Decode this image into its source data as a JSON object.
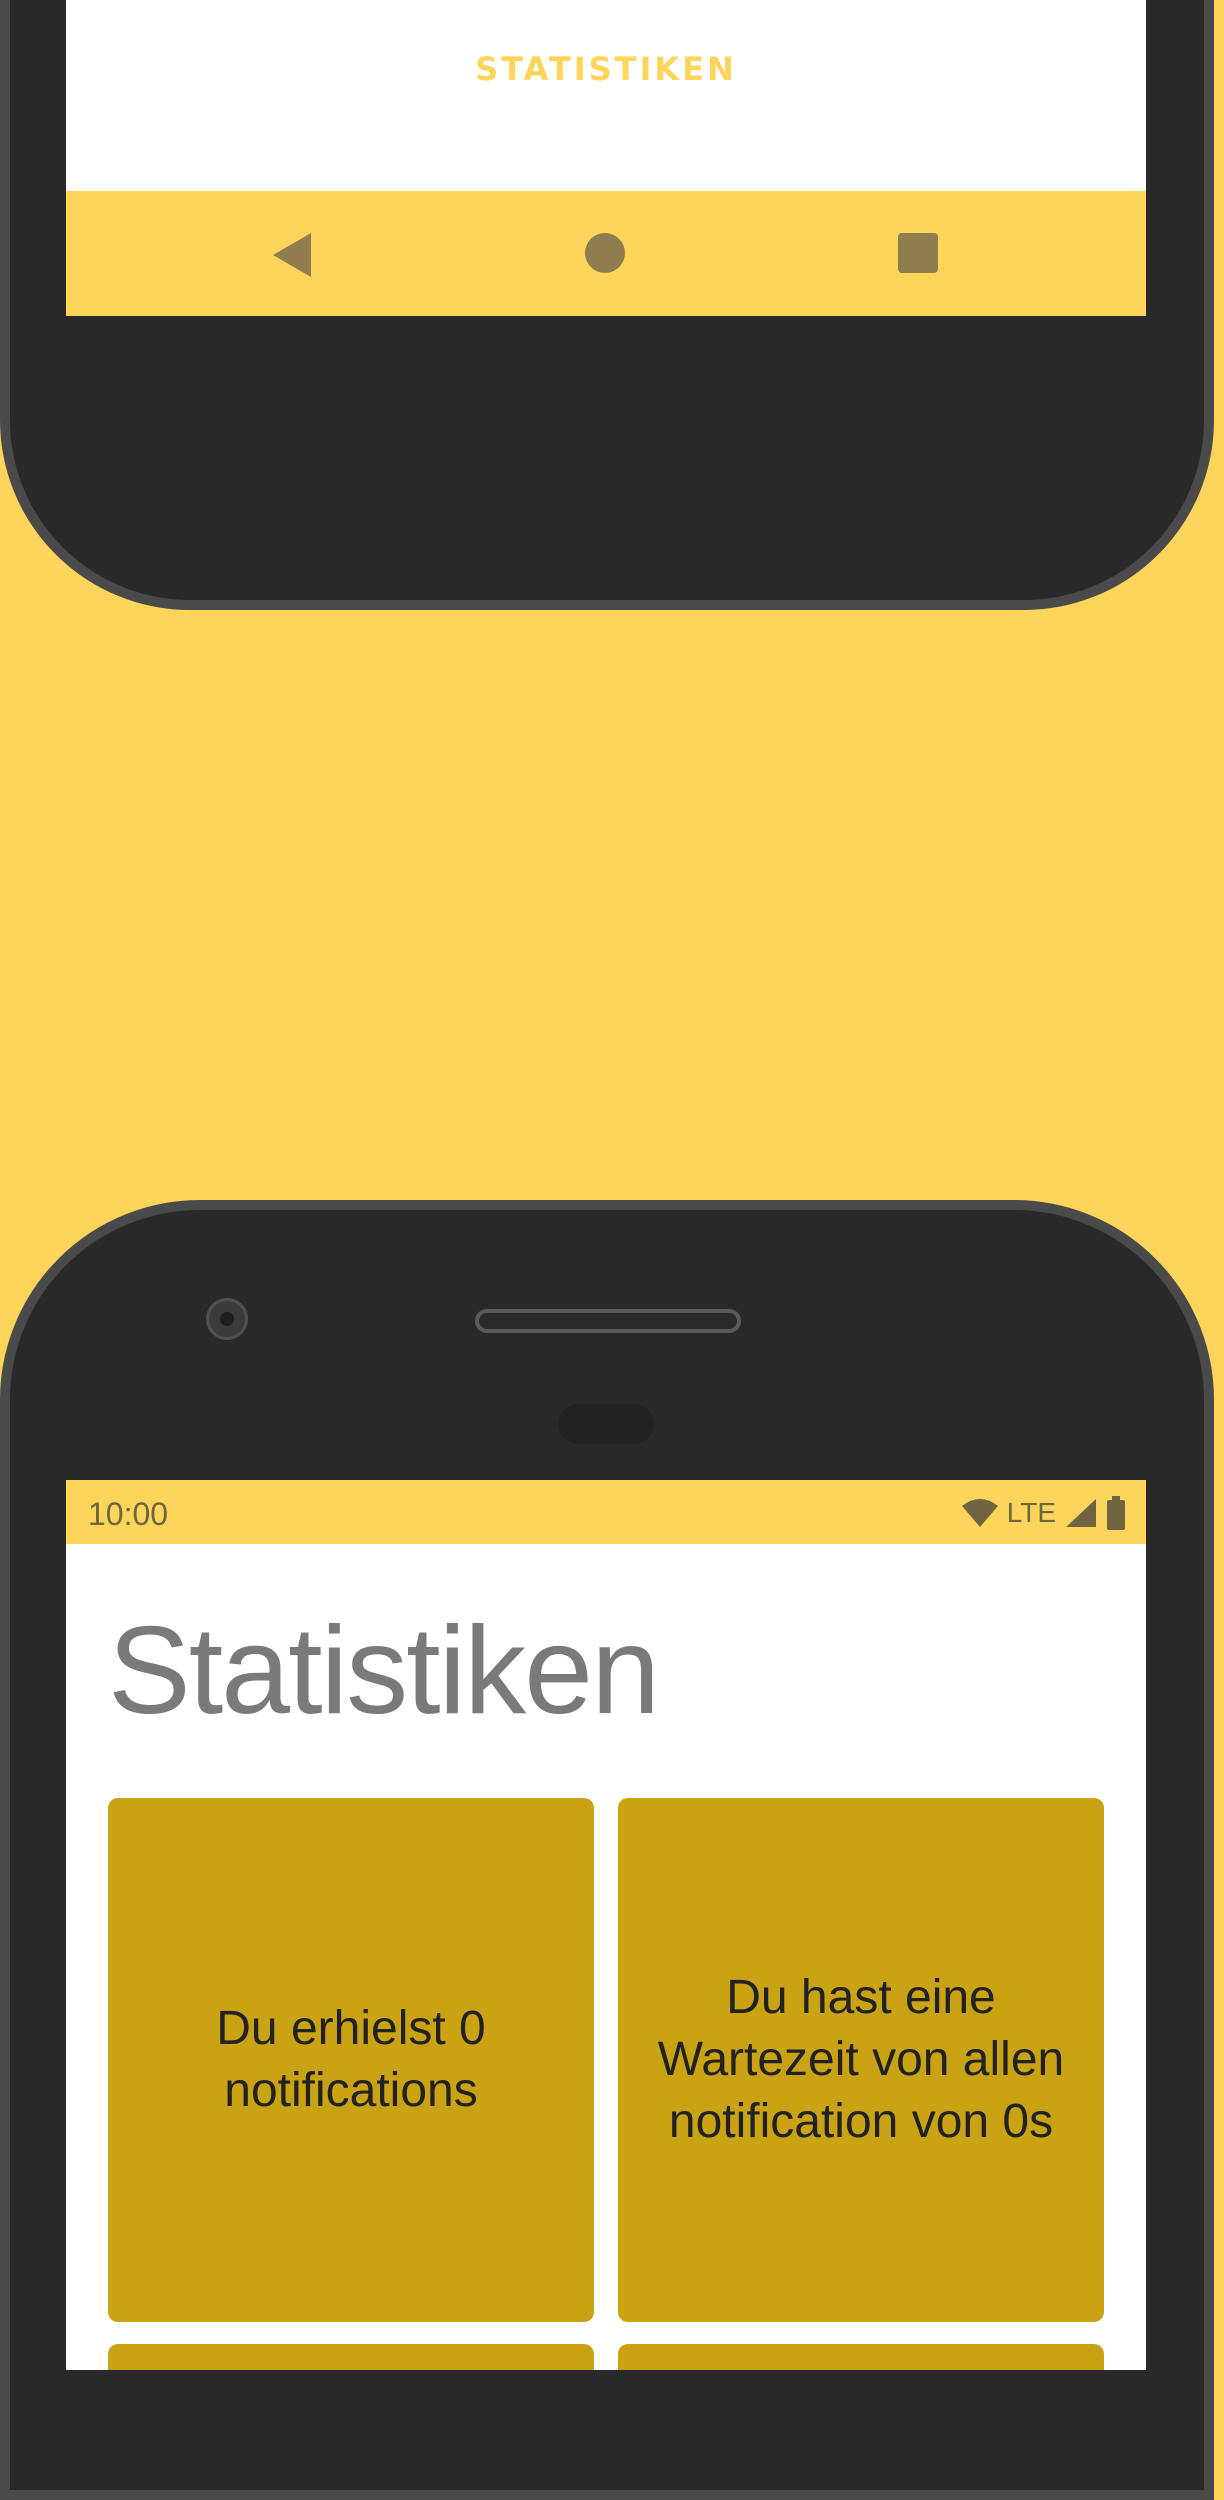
{
  "top_screen": {
    "tab_label": "STATISTIKEN"
  },
  "status_bar": {
    "time": "10:00",
    "network": "LTE"
  },
  "page": {
    "title": "Statistiken"
  },
  "cards": [
    {
      "text": "Du erhielst 0 notifications"
    },
    {
      "text": "Du hast eine Wartezeit von allen notification von 0s"
    }
  ],
  "colors": {
    "accent": "#FDD55A",
    "card": "#C9A314",
    "title": "#7a7a7a"
  }
}
